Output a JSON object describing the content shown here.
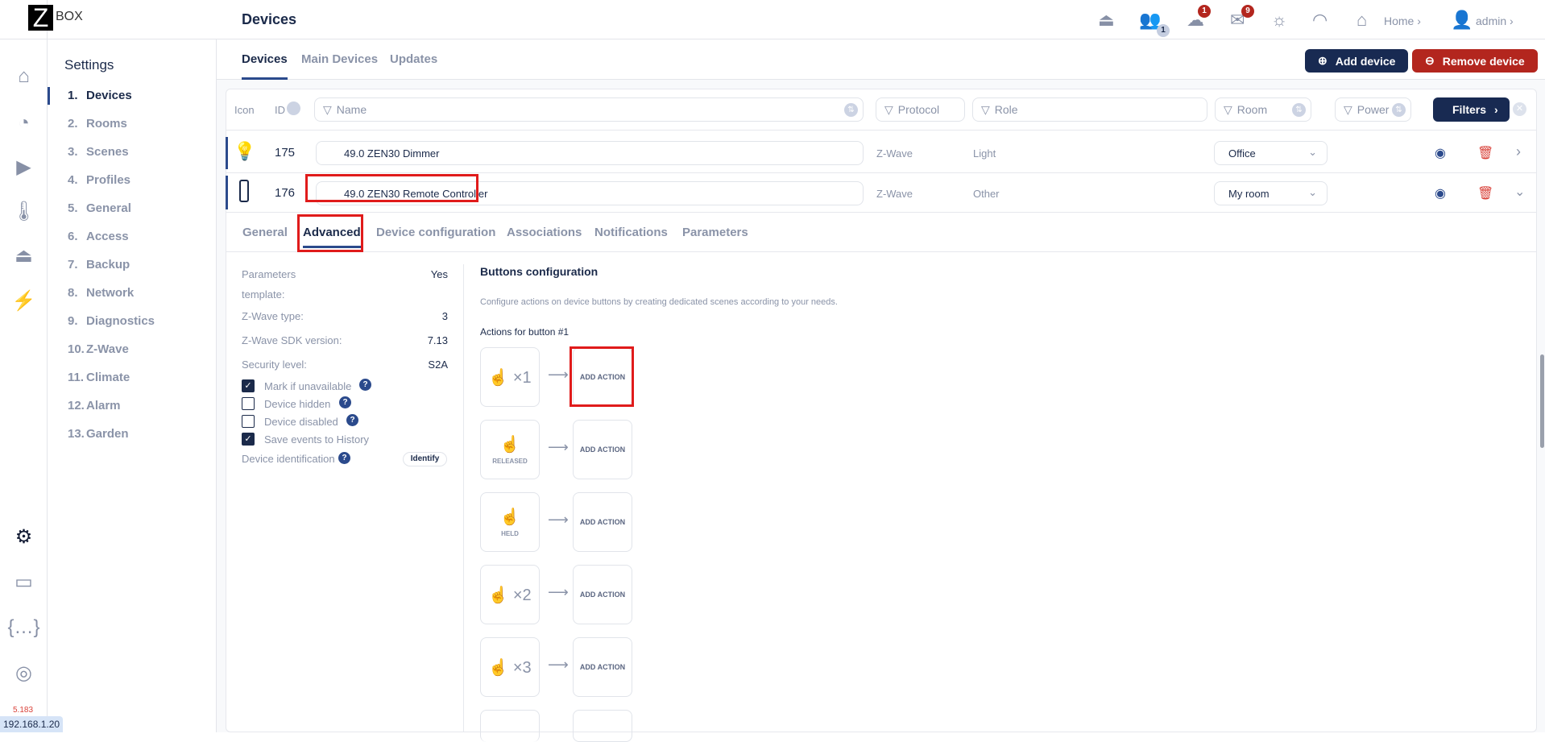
{
  "brand": {
    "logo_letter": "Z",
    "logo_text": "BOX"
  },
  "header": {
    "title": "Devices",
    "users_badge": "1",
    "download_badge": "1",
    "mail_badge": "9",
    "home_label": "Home",
    "user_label": "admin"
  },
  "settings": {
    "title": "Settings",
    "items": [
      {
        "num": "1.",
        "label": "Devices"
      },
      {
        "num": "2.",
        "label": "Rooms"
      },
      {
        "num": "3.",
        "label": "Scenes"
      },
      {
        "num": "4.",
        "label": "Profiles"
      },
      {
        "num": "5.",
        "label": "General"
      },
      {
        "num": "6.",
        "label": "Access"
      },
      {
        "num": "7.",
        "label": "Backup"
      },
      {
        "num": "8.",
        "label": "Network"
      },
      {
        "num": "9.",
        "label": "Diagnostics"
      },
      {
        "num": "10.",
        "label": "Z-Wave"
      },
      {
        "num": "11.",
        "label": "Climate"
      },
      {
        "num": "12.",
        "label": "Alarm"
      },
      {
        "num": "13.",
        "label": "Garden"
      }
    ]
  },
  "footer": {
    "version": "5.183",
    "ip": "192.168.1.20"
  },
  "tabs": [
    "Devices",
    "Main Devices",
    "Updates"
  ],
  "actions": {
    "add": "Add device",
    "remove": "Remove device"
  },
  "filters": {
    "icon": "Icon",
    "id": "ID",
    "name": "Name",
    "protocol": "Protocol",
    "role": "Role",
    "room": "Room",
    "power": "Power",
    "button": "Filters"
  },
  "devices": [
    {
      "id": "175",
      "name": "49.0 ZEN30 Dimmer",
      "protocol": "Z-Wave",
      "role": "Light",
      "room": "Office"
    },
    {
      "id": "176",
      "name": "49.0 ZEN30 Remote Controller",
      "protocol": "Z-Wave",
      "role": "Other",
      "room": "My room"
    }
  ],
  "subtabs": [
    "General",
    "Advanced",
    "Device configuration",
    "Associations",
    "Notifications",
    "Parameters"
  ],
  "info": {
    "params_label": "Parameters",
    "params_label2": "template:",
    "params_value": "Yes",
    "type_label": "Z-Wave type:",
    "type_value": "3",
    "sdk_label": "Z-Wave SDK version:",
    "sdk_value": "7.13",
    "security_label": "Security level:",
    "security_value": "S2A",
    "mark": "Mark if unavailable",
    "hidden": "Device hidden",
    "disabled": "Device disabled",
    "save": "Save events to History",
    "ident": "Device identification",
    "identify_btn": "Identify"
  },
  "buttons_config": {
    "title": "Buttons configuration",
    "desc": "Configure actions on device buttons by creating dedicated scenes according to your needs.",
    "subtitle": "Actions for button #1",
    "add_action": "ADD ACTION",
    "triggers": [
      {
        "label": "×1"
      },
      {
        "label": "RELEASED"
      },
      {
        "label": "HELD"
      },
      {
        "label": "×2"
      },
      {
        "label": "×3"
      }
    ]
  }
}
